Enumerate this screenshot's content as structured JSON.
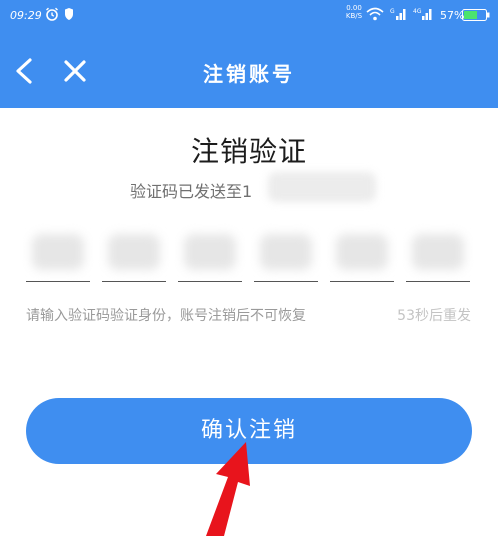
{
  "status_bar": {
    "time": "09:29",
    "net_speed_value": "0.00",
    "net_speed_unit": "KB/S",
    "battery": "57%"
  },
  "nav": {
    "title": "注销账号",
    "back_icon": "chevron-left-icon",
    "close_icon": "close-icon"
  },
  "main": {
    "heading": "注销验证",
    "sent_text": "验证码已发送至1",
    "code_digits": 6,
    "hint": "请输入验证码验证身份，账号注销后不可恢复",
    "resend_label": "53秒后重发",
    "confirm_label": "确认注销"
  },
  "colors": {
    "accent": "#3f8ef0",
    "annotation_arrow": "#e8141c"
  }
}
